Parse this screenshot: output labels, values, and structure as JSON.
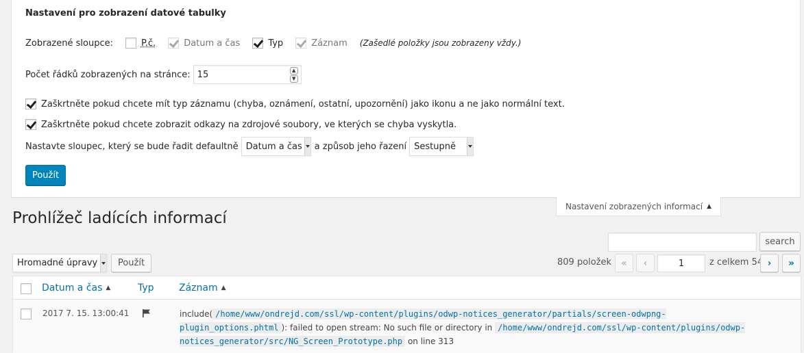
{
  "screen_options": {
    "title": "Nastavení pro zobrazení datové tabulky",
    "columns_label": "Zobrazené sloupce:",
    "columns": [
      {
        "label": "P.č.",
        "checked": false,
        "disabled": false
      },
      {
        "label": "Datum a čas",
        "checked": true,
        "disabled": true
      },
      {
        "label": "Typ",
        "checked": true,
        "disabled": false
      },
      {
        "label": "Záznam",
        "checked": true,
        "disabled": true
      }
    ],
    "columns_hint": "(Zašedlé položky jsou zobrazeny vždy.)",
    "per_page_label": "Počet řádků zobrazených na stránce:",
    "per_page_value": "15",
    "option_icon_label": "Zaškrtněte pokud chcete mít typ záznamu (chyba, oznámení, ostatní, upozornění) jako ikonu a ne jako normální text.",
    "option_links_label": "Zaškrtněte pokud chcete zobrazit odkazy na zdrojové soubory, ve kterých se chyba vyskytla.",
    "sort_label_before": "Nastavte sloupec, který se bude řadit defaultně",
    "sort_column_value": "Datum a čas",
    "sort_label_middle": "a způsob jeho řazení",
    "sort_order_value": "Sestupně",
    "apply_label": "Použít",
    "toggle_tab_label": "Nastavení zobrazených informací"
  },
  "page_title": "Prohlížeč ladících informací",
  "search": {
    "value": "",
    "button_label": "search"
  },
  "bulk": {
    "select_value": "Hromadné úpravy",
    "apply_label": "Použít"
  },
  "pagination": {
    "items_count": "809 položek",
    "first": "«",
    "prev": "‹",
    "next": "›",
    "last": "»",
    "current_page": "1",
    "total_label": "z celkem 54"
  },
  "table": {
    "columns": [
      "Datum a čas",
      "Typ",
      "Záznam"
    ],
    "rows": [
      {
        "date": "2017 7. 15. 13:00:41",
        "type_icon": "flag-icon",
        "message_prefix": "include(",
        "path1": "/home/www/ondrejd.com/ssl/wp-content/plugins/odwp-notices_generator/partials/screen-odwpng-plugin_options.phtml",
        "message_mid": "): failed to open stream: No such file or directory in",
        "path2": "/home/www/ondrejd.com/ssl/wp-content/plugins/odwp-notices_generator/src/NG_Screen_Prototype.php",
        "message_suffix": "on line 313"
      }
    ]
  },
  "colors": {
    "primary": "#0085ba",
    "link": "#0073aa",
    "background": "#f1f1f1"
  }
}
